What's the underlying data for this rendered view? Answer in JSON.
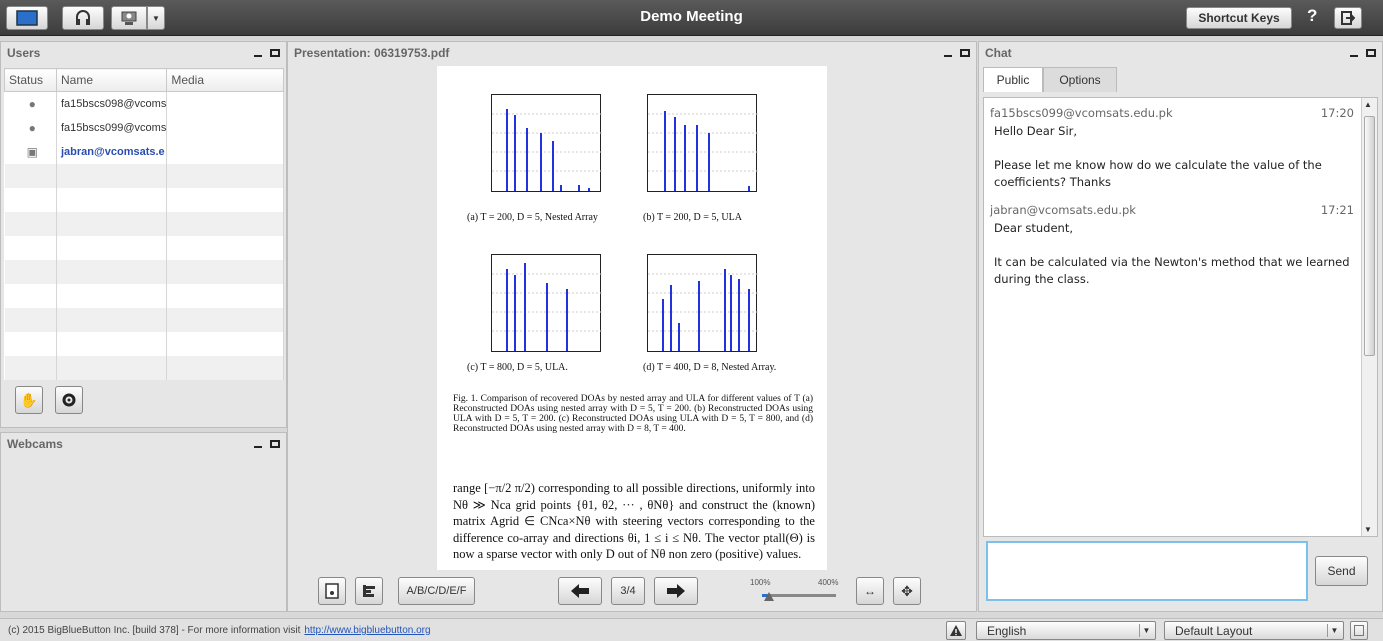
{
  "header": {
    "title": "Demo Meeting",
    "shortcut_keys": "Shortcut Keys",
    "help": "?"
  },
  "users_panel": {
    "title": "Users",
    "columns": [
      "Status",
      "Name",
      "Media"
    ],
    "rows": [
      {
        "name": "fa15bscs098@vcoms",
        "role": "viewer"
      },
      {
        "name": "fa15bscs099@vcoms",
        "role": "viewer"
      },
      {
        "name": "jabran@vcomsats.e",
        "role": "presenter"
      }
    ]
  },
  "webcams_panel": {
    "title": "Webcams"
  },
  "presentation": {
    "title": "Presentation: 06319753.pdf",
    "page": "3/4",
    "zoom_min": "100%",
    "zoom_max": "400%",
    "zoom_level": 0.1,
    "poll_label": "A/B/C/D/E/F",
    "slide": {
      "cap_a": "(a) T = 200, D = 5, Nested Array",
      "cap_b": "(b) T = 200, D = 5, ULA",
      "cap_c": "(c) T = 800, D = 5, ULA.",
      "cap_d": "(d) T = 400, D = 8, Nested Array.",
      "fig_caption": "Fig. 1. Comparison of recovered DOAs by nested array and ULA for different values of T (a) Reconstructed DOAs using nested array with D = 5, T = 200. (b) Reconstructed DOAs using ULA with D = 5, T = 200. (c) Reconstructed DOAs using ULA with D = 5, T = 800, and (d) Reconstructed DOAs using nested array with D = 8, T = 400.",
      "paragraph": "range [−π/2  π/2) corresponding to all possible directions, uniformly into Nθ ≫ Nca grid points {θ1, θ2, ··· , θNθ} and construct the (known) matrix Agrid ∈ CNca×Nθ with steering vectors corresponding to the difference co-array and directions θi, 1 ≤ i ≤ Nθ. The vector ptall(Θ) is now a sparse vector with only D out of Nθ non zero (positive) values."
    }
  },
  "chat": {
    "title": "Chat",
    "tabs": [
      "Public",
      "Options"
    ],
    "send": "Send",
    "messages": [
      {
        "from": "fa15bscs099@vcomsats.edu.pk",
        "time": "17:20",
        "lines": [
          "Hello Dear Sir,",
          "",
          "Please let me know how do we calculate the value of the coefficients? Thanks"
        ]
      },
      {
        "from": "jabran@vcomsats.edu.pk",
        "time": "17:21",
        "lines": [
          "Dear student,",
          "",
          "It can be calculated via the Newton's method that we learned during the class."
        ]
      }
    ]
  },
  "footer": {
    "copyright": "(c) 2015 BigBlueButton Inc. [build 378] - For more information visit",
    "link": "http://www.bigbluebutton.org",
    "language": "English",
    "layout": "Default Layout"
  },
  "colors": {
    "topbar": "#444444",
    "link": "#2255bb",
    "presenter": "#2a4db0",
    "plot_bar": "#2233dd"
  }
}
